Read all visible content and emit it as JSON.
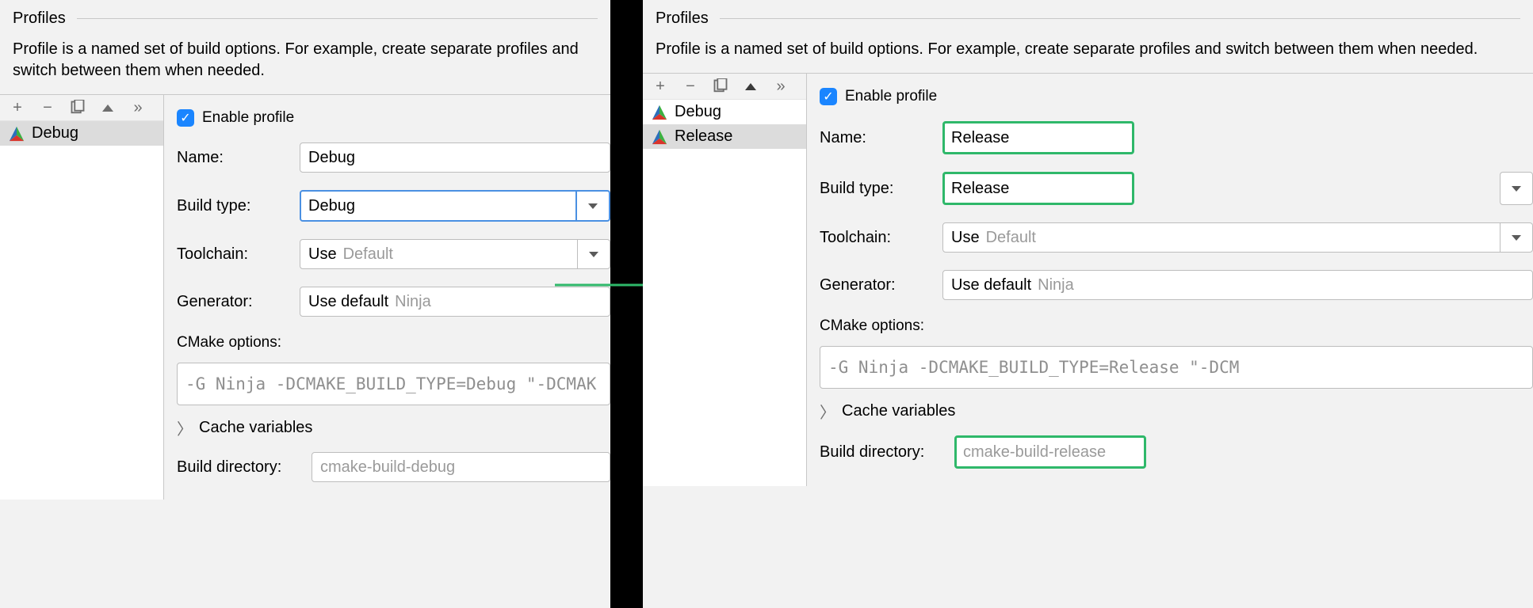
{
  "section_title": "Profiles",
  "description": "Profile is a named set of build options. For example, create separate profiles and switch between them when needed.",
  "toolbar_icons": {
    "add": "+",
    "remove": "−",
    "copy": "copy-icon",
    "up": "up-arrow-icon",
    "more": "»"
  },
  "enable_label": "Enable profile",
  "labels": {
    "name": "Name:",
    "build_type": "Build type:",
    "toolchain": "Toolchain:",
    "generator": "Generator:",
    "cmake_options": "CMake options:",
    "cache": "Cache variables",
    "build_dir": "Build directory:"
  },
  "toolchain_value": "Use",
  "toolchain_ghost": "Default",
  "generator_value": "Use default",
  "generator_ghost": "Ninja",
  "left": {
    "profiles": [
      {
        "name": "Debug",
        "selected": true
      }
    ],
    "name": "Debug",
    "build_type": "Debug",
    "cmake_cmd": "-G Ninja -DCMAKE_BUILD_TYPE=Debug \"-DCMAK",
    "build_dir": "cmake-build-debug"
  },
  "right": {
    "profiles": [
      {
        "name": "Debug",
        "selected": false
      },
      {
        "name": "Release",
        "selected": true
      }
    ],
    "name": "Release",
    "build_type": "Release",
    "cmake_cmd": "-G Ninja -DCMAKE_BUILD_TYPE=Release \"-DCM",
    "build_dir": "cmake-build-release"
  }
}
